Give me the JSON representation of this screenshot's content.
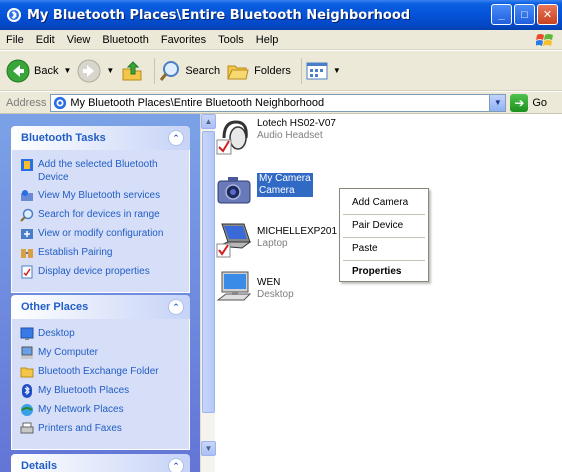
{
  "window": {
    "title": "My Bluetooth Places\\Entire Bluetooth Neighborhood",
    "controls": {
      "minimize": "_",
      "maximize": "□",
      "close": "✕"
    }
  },
  "menu": [
    "File",
    "Edit",
    "View",
    "Bluetooth",
    "Favorites",
    "Tools",
    "Help"
  ],
  "toolbar": {
    "back": "Back",
    "search": "Search",
    "folders": "Folders"
  },
  "address": {
    "label": "Address",
    "value": "My Bluetooth Places\\Entire Bluetooth Neighborhood",
    "go": "Go"
  },
  "taskpane": {
    "bluetooth_tasks": {
      "title": "Bluetooth Tasks",
      "items": [
        {
          "label": "Add the selected Bluetooth Device",
          "icon": "add-device-icon"
        },
        {
          "label": "View My Bluetooth services",
          "icon": "services-icon"
        },
        {
          "label": "Search for devices in range",
          "icon": "search-icon"
        },
        {
          "label": "View or modify configuration",
          "icon": "configuration-icon"
        },
        {
          "label": "Establish Pairing",
          "icon": "pairing-icon"
        },
        {
          "label": "Display device properties",
          "icon": "properties-icon"
        }
      ]
    },
    "other_places": {
      "title": "Other Places",
      "items": [
        {
          "label": "Desktop",
          "icon": "desktop-icon"
        },
        {
          "label": "My Computer",
          "icon": "computer-icon"
        },
        {
          "label": "Bluetooth Exchange Folder",
          "icon": "folder-icon"
        },
        {
          "label": "My Bluetooth Places",
          "icon": "bluetooth-icon"
        },
        {
          "label": "My Network Places",
          "icon": "network-icon"
        },
        {
          "label": "Printers and Faxes",
          "icon": "printer-icon"
        }
      ]
    },
    "details": {
      "title": "Details"
    }
  },
  "devices": [
    {
      "name": "Lotech HS02-V07",
      "type": "Audio Headset",
      "icon": "headset-icon",
      "paired": true
    },
    {
      "name": "My Camera",
      "type": "Camera",
      "icon": "camera-icon",
      "paired": false,
      "selected": true
    },
    {
      "name": "MICHELLEXP201",
      "type": "Laptop",
      "icon": "laptop-icon",
      "paired": true
    },
    {
      "name": "WEN",
      "type": "Desktop",
      "icon": "desktop-computer-icon",
      "paired": false
    }
  ],
  "context_menu": {
    "items": [
      "Add Camera",
      "Pair Device",
      "Paste",
      "Properties"
    ]
  },
  "colors": {
    "titlebar": "#0552d8",
    "taskpane": "#7ba2e7",
    "link": "#215dc6",
    "selection": "#316ac5"
  }
}
